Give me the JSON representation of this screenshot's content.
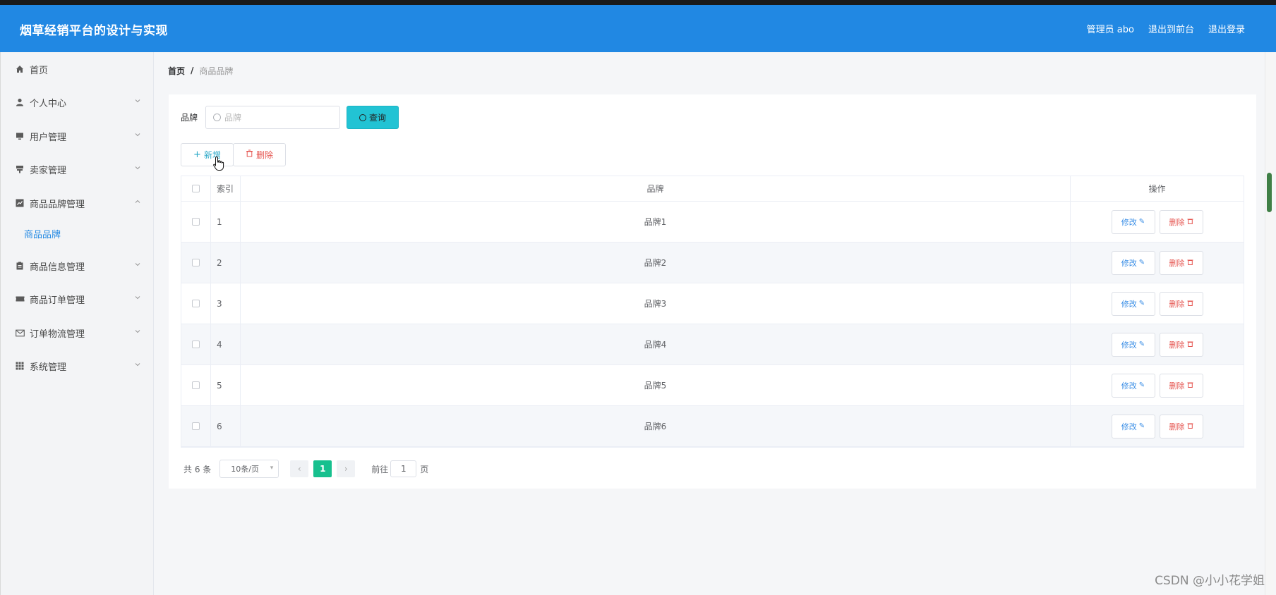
{
  "header": {
    "title": "烟草经销平台的设计与实现",
    "admin": "管理员 abo",
    "to_front": "退出到前台",
    "logout": "退出登录"
  },
  "sidebar": {
    "items": [
      {
        "label": "首页",
        "icon": "home-icon"
      },
      {
        "label": "个人中心",
        "icon": "user-icon"
      },
      {
        "label": "用户管理",
        "icon": "monitor-icon"
      },
      {
        "label": "卖家管理",
        "icon": "stand-icon"
      },
      {
        "label": "商品品牌管理",
        "icon": "chart-icon"
      },
      {
        "label": "商品信息管理",
        "icon": "clipboard-icon"
      },
      {
        "label": "商品订单管理",
        "icon": "ticket-icon"
      },
      {
        "label": "订单物流管理",
        "icon": "mail-icon"
      },
      {
        "label": "系统管理",
        "icon": "grid-icon"
      }
    ],
    "submenu_active": "商品品牌"
  },
  "breadcrumb": {
    "home": "首页",
    "separator": "/",
    "current": "商品品牌"
  },
  "search": {
    "label": "品牌",
    "placeholder": "品牌",
    "button": "查询"
  },
  "toolbar": {
    "add": "新增",
    "delete": "删除"
  },
  "table": {
    "columns": [
      "索引",
      "品牌",
      "操作"
    ],
    "rows": [
      {
        "index": "1",
        "brand": "品牌1"
      },
      {
        "index": "2",
        "brand": "品牌2"
      },
      {
        "index": "3",
        "brand": "品牌3"
      },
      {
        "index": "4",
        "brand": "品牌4"
      },
      {
        "index": "5",
        "brand": "品牌5"
      },
      {
        "index": "6",
        "brand": "品牌6"
      }
    ],
    "edit_label": "修改",
    "delete_label": "删除"
  },
  "pagination": {
    "total": "共 6 条",
    "page_size": "10条/页",
    "current_page": "1",
    "goto_label": "前往",
    "goto_value": "1",
    "page_suffix": "页"
  },
  "watermark": "CSDN @小小花学姐",
  "colors": {
    "header": "#2188e3",
    "query_button": "#22c3d4",
    "active_page": "#17c08e",
    "danger": "#e5544f"
  }
}
